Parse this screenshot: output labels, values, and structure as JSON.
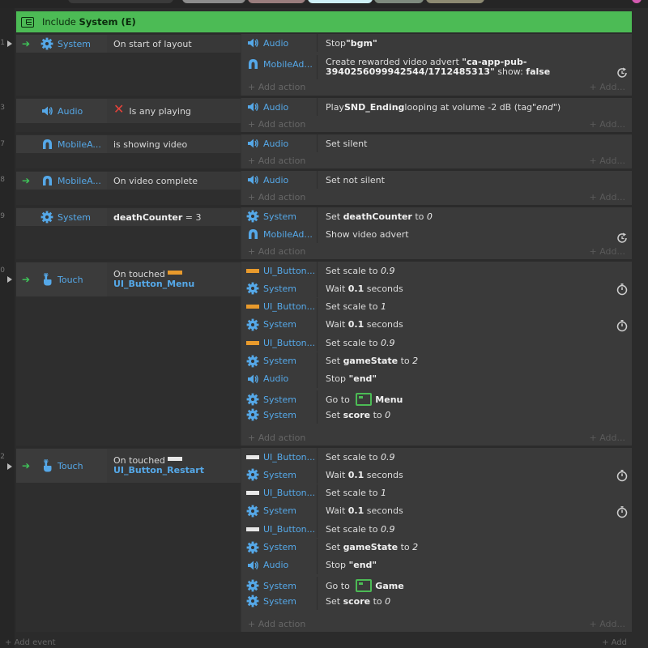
{
  "include": {
    "prefix": "Include",
    "name": "System (E)"
  },
  "gutter": {
    "numbers": [
      "1",
      "3",
      "7",
      "8",
      "9",
      "0",
      "2"
    ]
  },
  "events": [
    {
      "cond": {
        "object": "System",
        "text": "On start of layout"
      },
      "actions": [
        {
          "object": "Audio",
          "text_plain": "Stop ",
          "text_bold": "\"bgm\""
        },
        {
          "object": "MobileAd...",
          "line1_plain": "Create rewarded video advert ",
          "line1_bold": "\"ca-app-pub-",
          "line2_bold": "3940256099942544/1712485313\"",
          "line2_plain": " show: ",
          "line2_bold2": "false"
        }
      ]
    },
    {
      "cond": {
        "object": "Audio",
        "text": "Is any playing"
      },
      "actions": [
        {
          "object": "Audio",
          "text_plain": "Play ",
          "text_bold": "SND_Ending",
          "text_plain2": " looping at volume -2 dB (tag ",
          "text_italic": "\"end\"",
          "text_plain3": ")"
        }
      ]
    },
    {
      "cond": {
        "object": "MobileA...",
        "text": "is showing video"
      },
      "actions": [
        {
          "object": "Audio",
          "text_plain": "Set silent"
        }
      ]
    },
    {
      "cond": {
        "object": "MobileA...",
        "text": "On video complete"
      },
      "actions": [
        {
          "object": "Audio",
          "text_plain": "Set not silent"
        }
      ]
    },
    {
      "cond": {
        "object": "System",
        "text_bold": "deathCounter",
        "text_plain": " = 3"
      },
      "actions": [
        {
          "object": "System",
          "text_plain": "Set ",
          "text_bold": "deathCounter",
          "text_plain2": " to ",
          "text_italic": "0"
        },
        {
          "object": "MobileAd...",
          "text_plain": "Show video advert"
        }
      ]
    },
    {
      "cond": {
        "object": "Touch",
        "line1": "On touched",
        "line2": "UI_Button_Menu"
      },
      "actions": [
        {
          "object": "UI_Button...",
          "text_plain": "Set scale to ",
          "text_italic": "0.9"
        },
        {
          "object": "System",
          "text_plain": "Wait ",
          "text_bold": "0.1",
          "text_plain2": " seconds"
        },
        {
          "object": "UI_Button...",
          "text_plain": "Set scale to ",
          "text_italic": "1"
        },
        {
          "object": "System",
          "text_plain": "Wait ",
          "text_bold": "0.1",
          "text_plain2": " seconds"
        },
        {
          "object": "UI_Button...",
          "text_plain": "Set scale to ",
          "text_italic": "0.9"
        },
        {
          "object": "System",
          "text_plain": "Set ",
          "text_bold": "gameState",
          "text_plain2": " to ",
          "text_italic": "2"
        },
        {
          "object": "Audio",
          "text_plain": "Stop ",
          "text_bold": "\"end\""
        },
        {
          "object": "System",
          "text_plain": "Go to ",
          "text_bold": "Menu"
        },
        {
          "object": "System",
          "text_plain": "Set ",
          "text_bold": "score",
          "text_plain2": " to ",
          "text_italic": "0"
        }
      ]
    },
    {
      "cond": {
        "object": "Touch",
        "line1": "On touched",
        "line2": "UI_Button_Restart"
      },
      "actions": [
        {
          "object": "UI_Button...",
          "text_plain": "Set scale to ",
          "text_italic": "0.9"
        },
        {
          "object": "System",
          "text_plain": "Wait ",
          "text_bold": "0.1",
          "text_plain2": " seconds"
        },
        {
          "object": "UI_Button...",
          "text_plain": "Set scale to ",
          "text_italic": "1"
        },
        {
          "object": "System",
          "text_plain": "Wait ",
          "text_bold": "0.1",
          "text_plain2": " seconds"
        },
        {
          "object": "UI_Button...",
          "text_plain": "Set scale to ",
          "text_italic": "0.9"
        },
        {
          "object": "System",
          "text_plain": "Set ",
          "text_bold": "gameState",
          "text_plain2": " to ",
          "text_italic": "2"
        },
        {
          "object": "Audio",
          "text_plain": "Stop ",
          "text_bold": "\"end\""
        },
        {
          "object": "System",
          "text_plain": "Go to ",
          "text_bold": "Game"
        },
        {
          "object": "System",
          "text_plain": "Set ",
          "text_bold": "score",
          "text_plain2": " to ",
          "text_italic": "0"
        }
      ]
    }
  ],
  "labels": {
    "add_action": "Add action",
    "add_short": "Add...",
    "add_event": "Add event",
    "add_event_right": "Add"
  },
  "colors": {
    "include_bg": "#4cbb55",
    "object_blue": "#55a8e8",
    "trigger_green": "#3fc85a",
    "invert_red": "#e5423a",
    "badge_orange": "#e89a2c"
  },
  "icons": {
    "system": "gear-icon",
    "audio": "speaker-icon",
    "mobile_ad": "mobile-ad-icon",
    "touch": "hand-icon",
    "ui_button": "sprite-thumbnail-icon",
    "wait": "stopwatch-icon",
    "advert": "refresh-icon",
    "layout": "layout-icon",
    "invert": "invert-x-icon",
    "trigger": "trigger-arrow-icon",
    "include": "include-sheet-icon"
  }
}
